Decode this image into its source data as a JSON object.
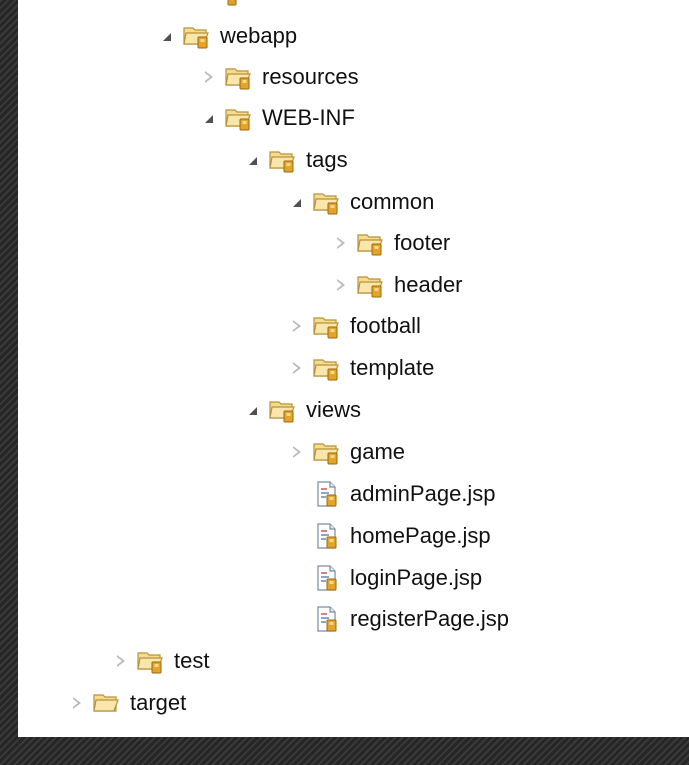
{
  "tree": [
    {
      "label": "webapp",
      "expander": "expanded",
      "icon": "package-folder-icon"
    },
    {
      "label": "resources",
      "expander": "collapsed",
      "icon": "package-folder-icon"
    },
    {
      "label": "WEB-INF",
      "expander": "expanded",
      "icon": "package-folder-icon"
    },
    {
      "label": "tags",
      "expander": "expanded",
      "icon": "package-folder-icon"
    },
    {
      "label": "common",
      "expander": "expanded",
      "icon": "package-folder-icon"
    },
    {
      "label": "footer",
      "expander": "collapsed",
      "icon": "package-folder-icon"
    },
    {
      "label": "header",
      "expander": "collapsed",
      "icon": "package-folder-icon"
    },
    {
      "label": "football",
      "expander": "collapsed",
      "icon": "package-folder-icon"
    },
    {
      "label": "template",
      "expander": "collapsed",
      "icon": "package-folder-icon"
    },
    {
      "label": "views",
      "expander": "expanded",
      "icon": "package-folder-icon"
    },
    {
      "label": "game",
      "expander": "collapsed",
      "icon": "package-folder-icon"
    },
    {
      "label": "adminPage.jsp",
      "expander": "none",
      "icon": "jsp-file-icon"
    },
    {
      "label": "homePage.jsp",
      "expander": "none",
      "icon": "jsp-file-icon"
    },
    {
      "label": "loginPage.jsp",
      "expander": "none",
      "icon": "jsp-file-icon"
    },
    {
      "label": "registerPage.jsp",
      "expander": "none",
      "icon": "jsp-file-icon"
    },
    {
      "label": "test",
      "expander": "collapsed",
      "icon": "package-folder-icon"
    },
    {
      "label": "target",
      "expander": "collapsed",
      "icon": "plain-folder-icon"
    }
  ],
  "colors": {
    "folder_yellow": "#f3d27a",
    "jar_orange": "#d9a22a",
    "text": "#111111",
    "background_dark": "#2e2e2e"
  }
}
